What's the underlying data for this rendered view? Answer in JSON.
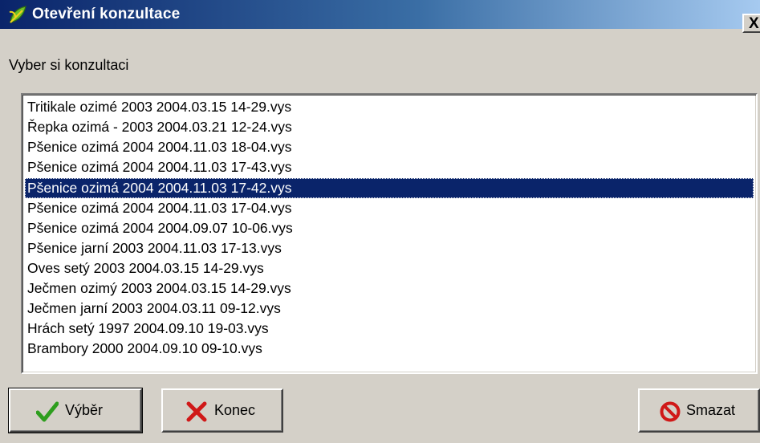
{
  "window": {
    "title": "Otevření konzultace",
    "close_symbol": "X",
    "icon": "leaf-app-icon"
  },
  "prompt": "Vyber si konzultaci",
  "list": {
    "selected_index": 4,
    "items": [
      "Tritikale ozimé 2003 2004.03.15 14-29.vys",
      "Řepka ozimá - 2003 2004.03.21 12-24.vys",
      "Pšenice ozimá 2004 2004.11.03 18-04.vys",
      "Pšenice ozimá 2004 2004.11.03 17-43.vys",
      "Pšenice ozimá 2004 2004.11.03 17-42.vys",
      "Pšenice ozimá 2004 2004.11.03 17-04.vys",
      "Pšenice ozimá 2004 2004.09.07 10-06.vys",
      "Pšenice jarní 2003 2004.11.03 17-13.vys",
      "Oves setý 2003 2004.03.15 14-29.vys",
      "Ječmen ozimý 2003 2004.03.15 14-29.vys",
      "Ječmen jarní 2003 2004.03.11 09-12.vys",
      "Hrách setý 1997 2004.09.10 19-03.vys",
      "Brambory 2000 2004.09.10 09-10.vys"
    ]
  },
  "buttons": {
    "select_label": "Výběr",
    "close_label": "Konec",
    "delete_label": "Smazat"
  },
  "colors": {
    "selection": "#0a246a",
    "check_green": "#2e9e1e",
    "cross_red": "#d01818"
  }
}
